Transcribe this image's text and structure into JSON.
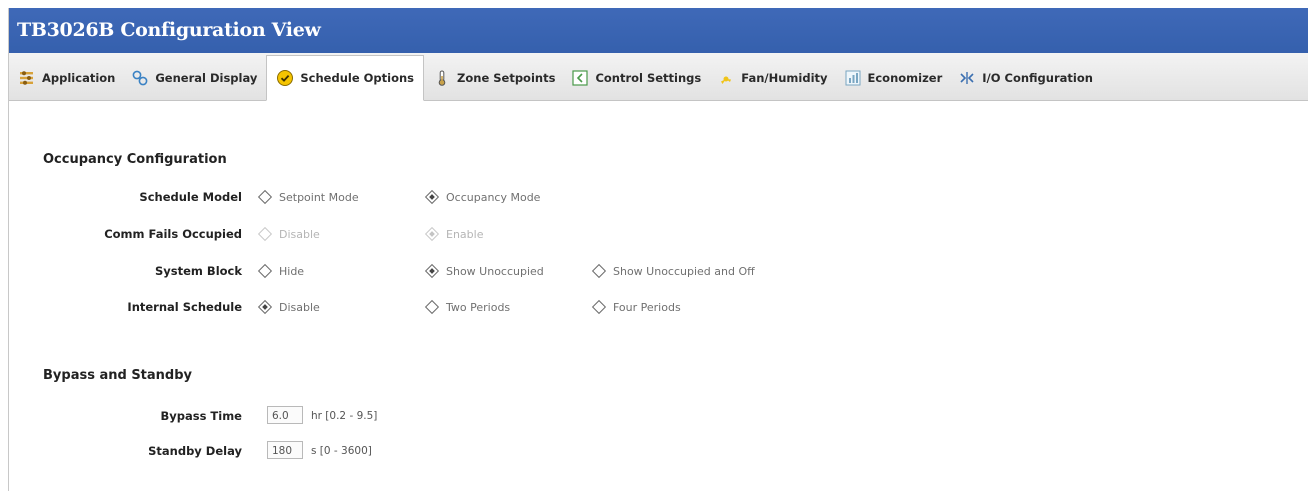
{
  "window": {
    "title": "TB3026B Configuration View"
  },
  "tabs": [
    {
      "label": "Application",
      "icon": "application-icon",
      "active": false
    },
    {
      "label": "General Display",
      "icon": "display-icon",
      "active": false
    },
    {
      "label": "Schedule Options",
      "icon": "schedule-icon",
      "active": true
    },
    {
      "label": "Zone Setpoints",
      "icon": "thermometer-icon",
      "active": false
    },
    {
      "label": "Control Settings",
      "icon": "control-settings-icon",
      "active": false
    },
    {
      "label": "Fan/Humidity",
      "icon": "fan-icon",
      "active": false
    },
    {
      "label": "Economizer",
      "icon": "economizer-icon",
      "active": false
    },
    {
      "label": "I/O Configuration",
      "icon": "io-config-icon",
      "active": false
    }
  ],
  "occupancy": {
    "title": "Occupancy Configuration",
    "rows": [
      {
        "label": "Schedule Model",
        "disabled": false,
        "options": [
          {
            "label": "Setpoint Mode",
            "selected": false
          },
          {
            "label": "Occupancy Mode",
            "selected": true
          }
        ]
      },
      {
        "label": "Comm Fails Occupied",
        "disabled": true,
        "options": [
          {
            "label": "Disable",
            "selected": false
          },
          {
            "label": "Enable",
            "selected": true
          }
        ]
      },
      {
        "label": "System Block",
        "disabled": false,
        "options": [
          {
            "label": "Hide",
            "selected": false
          },
          {
            "label": "Show Unoccupied",
            "selected": true
          },
          {
            "label": "Show Unoccupied and Off",
            "selected": false
          }
        ]
      },
      {
        "label": "Internal Schedule",
        "disabled": false,
        "options": [
          {
            "label": "Disable",
            "selected": true
          },
          {
            "label": "Two Periods",
            "selected": false
          },
          {
            "label": "Four Periods",
            "selected": false
          }
        ]
      }
    ]
  },
  "bypass": {
    "title": "Bypass and Standby",
    "bypass_time": {
      "label": "Bypass Time",
      "value": "6.0",
      "unit": "hr [0.2 - 9.5]"
    },
    "standby_delay": {
      "label": "Standby Delay",
      "value": "180",
      "unit": "s [0 - 3600]"
    }
  }
}
